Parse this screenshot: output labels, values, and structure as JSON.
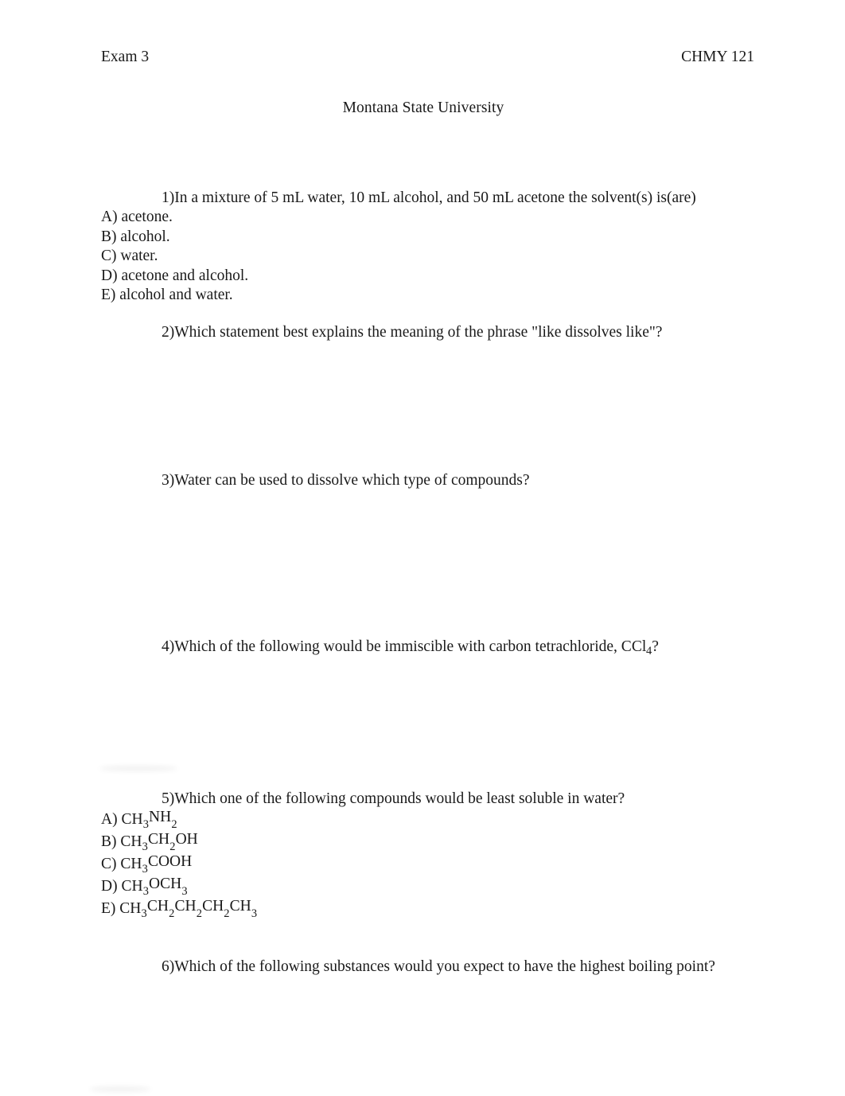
{
  "document": {
    "header": {
      "left": "Exam 3",
      "right": "CHMY 121",
      "institution": "Montana State University"
    },
    "questions": [
      {
        "number": "1)",
        "text": "In a mixture of 5 mL water, 10 mL alcohol, and 50 mL acetone the solvent(s) is(are)",
        "options": [
          {
            "letter": "A)",
            "text": "acetone."
          },
          {
            "letter": "B)",
            "text": "alcohol."
          },
          {
            "letter": "C)",
            "text": "water."
          },
          {
            "letter": "D)",
            "text": "acetone and alcohol."
          },
          {
            "letter": "E)",
            "text": "alcohol and water."
          }
        ]
      },
      {
        "number": "2)",
        "text": "Which statement best explains the meaning of the phrase \"like dissolves like\"?",
        "options": []
      },
      {
        "number": "3)",
        "text": "Water can be used to dissolve which type of compounds?",
        "options": []
      },
      {
        "number": "4)",
        "text_before_formula": "Which of the following would be immiscible with carbon tetrachloride, CCl",
        "formula_subscript": "4",
        "text_after_formula": "?",
        "options": []
      },
      {
        "number": "5)",
        "text": "Which one of the following compounds would be least soluble in water?",
        "options": [
          {
            "letter": "A)",
            "formula": "CH3NH2"
          },
          {
            "letter": "B)",
            "formula": "CH3CH2OH"
          },
          {
            "letter": "C)",
            "formula": "CH3COOH"
          },
          {
            "letter": "D)",
            "formula": "CH3OCH3"
          },
          {
            "letter": "E)",
            "formula": "CH3CH2CH2CH2CH3"
          }
        ]
      },
      {
        "number": "6)",
        "text": "Which of the following substances would you expect to have the highest boiling point?",
        "options": []
      }
    ]
  }
}
